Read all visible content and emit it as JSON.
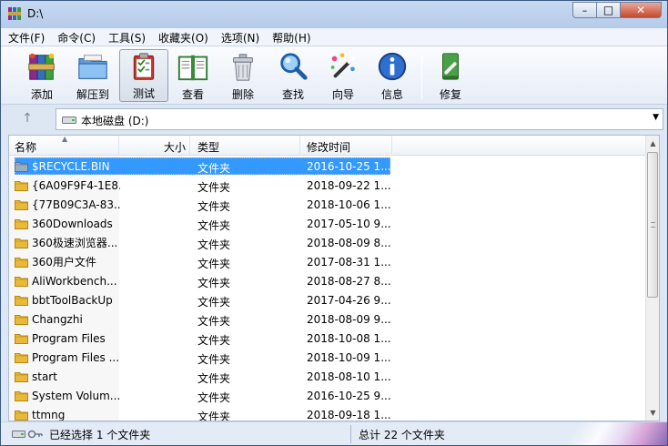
{
  "window": {
    "title": "D:\\"
  },
  "titlebar": {
    "min": "–",
    "max": "□",
    "close": "✕"
  },
  "menu": [
    "文件(F)",
    "命令(C)",
    "工具(S)",
    "收藏夹(O)",
    "选项(N)",
    "帮助(H)"
  ],
  "toolbar": [
    {
      "label": "添加",
      "icon": "add-archive-icon"
    },
    {
      "label": "解压到",
      "icon": "extract-folder-icon"
    },
    {
      "label": "测试",
      "icon": "test-clipboard-icon"
    },
    {
      "label": "查看",
      "icon": "view-book-icon"
    },
    {
      "label": "删除",
      "icon": "trash-icon"
    },
    {
      "label": "查找",
      "icon": "magnifier-icon"
    },
    {
      "label": "向导",
      "icon": "wizard-wand-icon"
    },
    {
      "label": "信息",
      "icon": "info-icon"
    },
    {
      "label": "修复",
      "icon": "repair-icon"
    }
  ],
  "address": {
    "up": "↑",
    "path": "本地磁盘 (D:)",
    "dropdown": "▼"
  },
  "columns": {
    "name": "名称",
    "size": "大小",
    "type": "类型",
    "modified": "修改时间"
  },
  "files": [
    {
      "name": "$RECYCLE.BIN",
      "type": "文件夹",
      "modified": "2016-10-25 1...",
      "selected": true,
      "special": true
    },
    {
      "name": "{6A09F9F4-1E8...",
      "type": "文件夹",
      "modified": "2018-09-22 1..."
    },
    {
      "name": "{77B09C3A-83...",
      "type": "文件夹",
      "modified": "2018-10-06 1..."
    },
    {
      "name": "360Downloads",
      "type": "文件夹",
      "modified": "2017-05-10 9..."
    },
    {
      "name": "360极速浏览器...",
      "type": "文件夹",
      "modified": "2018-08-09 8..."
    },
    {
      "name": "360用户文件",
      "type": "文件夹",
      "modified": "2017-08-31 1..."
    },
    {
      "name": "AliWorkbench...",
      "type": "文件夹",
      "modified": "2018-08-27 8..."
    },
    {
      "name": "bbtToolBackUp",
      "type": "文件夹",
      "modified": "2017-04-26 9..."
    },
    {
      "name": "Changzhi",
      "type": "文件夹",
      "modified": "2018-08-09 9..."
    },
    {
      "name": "Program Files",
      "type": "文件夹",
      "modified": "2018-10-08 1..."
    },
    {
      "name": "Program Files ...",
      "type": "文件夹",
      "modified": "2018-10-09 1..."
    },
    {
      "name": "start",
      "type": "文件夹",
      "modified": "2018-08-10 1..."
    },
    {
      "name": "System Volum...",
      "type": "文件夹",
      "modified": "2016-10-25 9..."
    },
    {
      "name": "ttmng",
      "type": "文件夹",
      "modified": "2018-09-18 1..."
    }
  ],
  "status": {
    "left": "已经选择 1 个文件夹",
    "right": "总计 22 个文件夹"
  },
  "colors": {
    "selection": "#3399ff",
    "folder": "#e8b93a",
    "window_frame": "#b4cbe9"
  }
}
